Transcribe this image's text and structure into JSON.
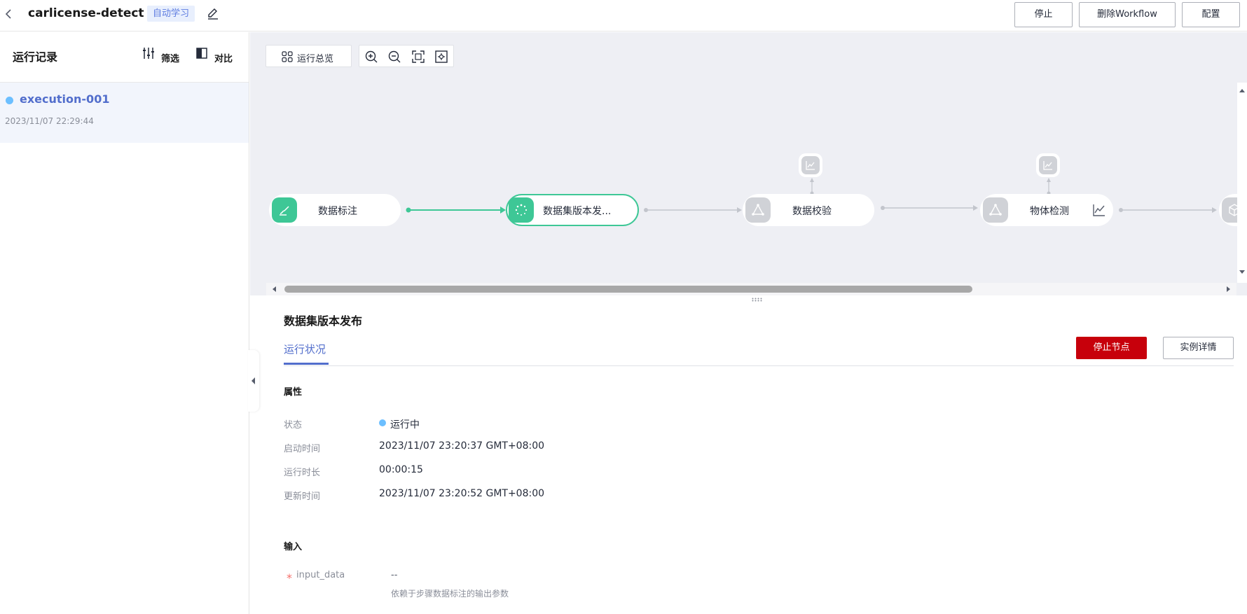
{
  "header": {
    "back_icon": "chevron-left-icon",
    "title": "carlicense-detect",
    "tag": "自动学习",
    "edit_icon": "pencil-icon",
    "buttons": {
      "stop": "停止",
      "delete": "删除Workflow",
      "config": "配置"
    }
  },
  "sidebar": {
    "title": "运行记录",
    "filter_label": "筛选",
    "compare_label": "对比",
    "runs": [
      {
        "name": "execution-001",
        "time": "2023/11/07 22:29:44",
        "status_color": "#6cbfff"
      }
    ]
  },
  "canvas": {
    "overview_label": "运行总览",
    "zoom_icons": [
      "zoom-in-icon",
      "zoom-out-icon",
      "fit-screen-icon",
      "center-icon"
    ],
    "nodes": [
      {
        "label": "数据标注",
        "state": "done",
        "color": "#3ec796"
      },
      {
        "label": "数据集版本发...",
        "state": "running",
        "color": "#3ec796"
      },
      {
        "label": "数据校验",
        "state": "pending",
        "color": "#d0d2d7"
      },
      {
        "label": "物体检测",
        "state": "pending",
        "color": "#d0d2d7"
      }
    ]
  },
  "detail": {
    "title": "数据集版本发布",
    "tab": "运行状况",
    "btn_stop_node": "停止节点",
    "btn_instance": "实例详情",
    "section_props": "属性",
    "props": {
      "status_label": "状态",
      "status_value": "运行中",
      "start_label": "启动时间",
      "start_value": "2023/11/07 23:20:37 GMT+08:00",
      "duration_label": "运行时长",
      "duration_value": "00:00:15",
      "update_label": "更新时间",
      "update_value": "2023/11/07 23:20:52 GMT+08:00"
    },
    "section_input": "输入",
    "input": {
      "required_mark": "*",
      "name": "input_data",
      "value": "--",
      "desc": "依赖于步骤数据标注的输出参数"
    }
  },
  "colors": {
    "accent": "#526ecc",
    "success": "#3ec796",
    "danger": "#c7000b",
    "running": "#6cbfff"
  }
}
